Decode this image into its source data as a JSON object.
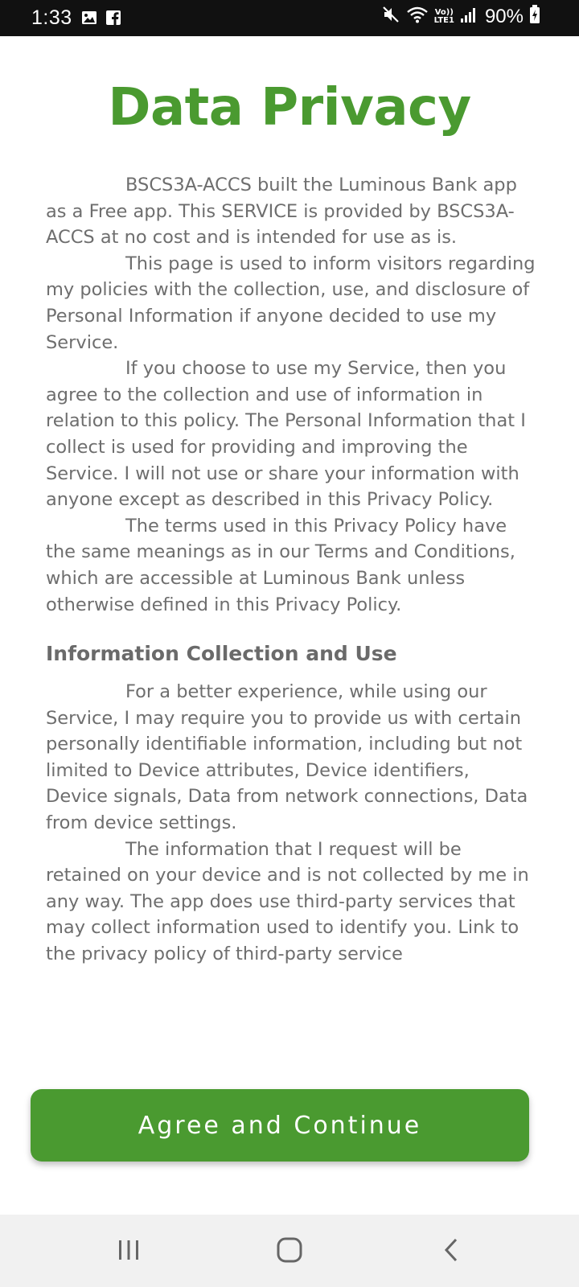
{
  "status_bar": {
    "time": "1:33",
    "lte_top": "Vo))",
    "lte_bottom": "LTE1",
    "battery": "90%"
  },
  "page": {
    "title": "Data Privacy",
    "paragraphs_1": [
      "BSCS3A-ACCS built the Luminous Bank app as a Free app. This SERVICE is provided by BSCS3A-ACCS at no cost and is intended for use as is.",
      "This page is used to inform visitors regarding my policies with the collection, use, and disclosure of Personal Information if anyone decided to use my Service.",
      "If you choose to use my Service, then you agree to the collection and use of information in relation to this policy. The Personal Information that I collect is used for providing and improving the Service. I will not use or share your information with anyone except as described in this Privacy Policy.",
      "The terms used in this Privacy Policy have the same meanings as in our Terms and Conditions, which are accessible at Luminous Bank unless otherwise defined in this Privacy Policy."
    ],
    "section_heading": "Information Collection and Use",
    "paragraphs_2": [
      "For a better experience, while using our Service, I may require you to provide us with certain personally identifiable information, including but not limited to Device attributes, Device identifiers, Device signals, Data from network connections, Data from device settings.",
      "The information that I request will be retained on your device and is not collected by me in any way. The app does use third-party services that may collect information used to identify you. Link to the privacy policy of third-party service"
    ],
    "agree_button": "Agree and Continue"
  },
  "colors": {
    "accent": "#4a9a30",
    "text": "#6e6e6e",
    "status_bar": "#111111",
    "nav_bar": "#f1f1f1"
  },
  "icons": {
    "status_left": [
      "gallery-icon",
      "facebook-icon"
    ],
    "status_right": [
      "mute-icon",
      "wifi-icon",
      "signal-icon",
      "battery-charging-icon"
    ],
    "nav": [
      "recents-icon",
      "home-icon",
      "back-icon"
    ]
  }
}
